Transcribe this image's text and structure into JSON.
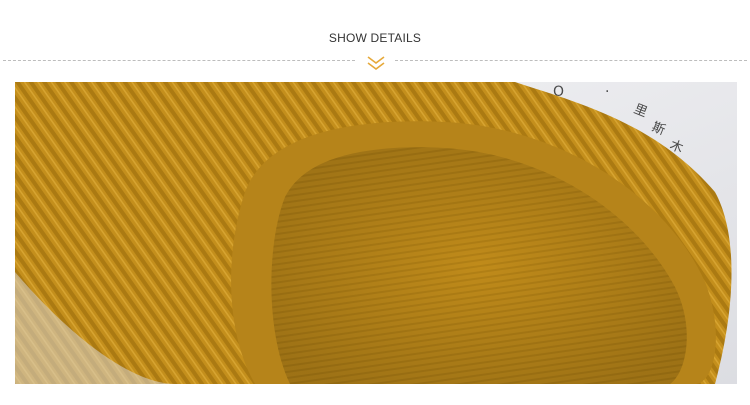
{
  "header": {
    "title": "SHOW DETAILS"
  },
  "photo": {
    "subject": "mustard-yellow knit sock detail",
    "packaging_text": [
      "O",
      "·",
      "里",
      "斯",
      "木"
    ]
  },
  "colors": {
    "accent": "#e6a93a",
    "fabric": "#c7921d",
    "fabric_dark": "#9c6e10",
    "background": "#ffffff"
  }
}
